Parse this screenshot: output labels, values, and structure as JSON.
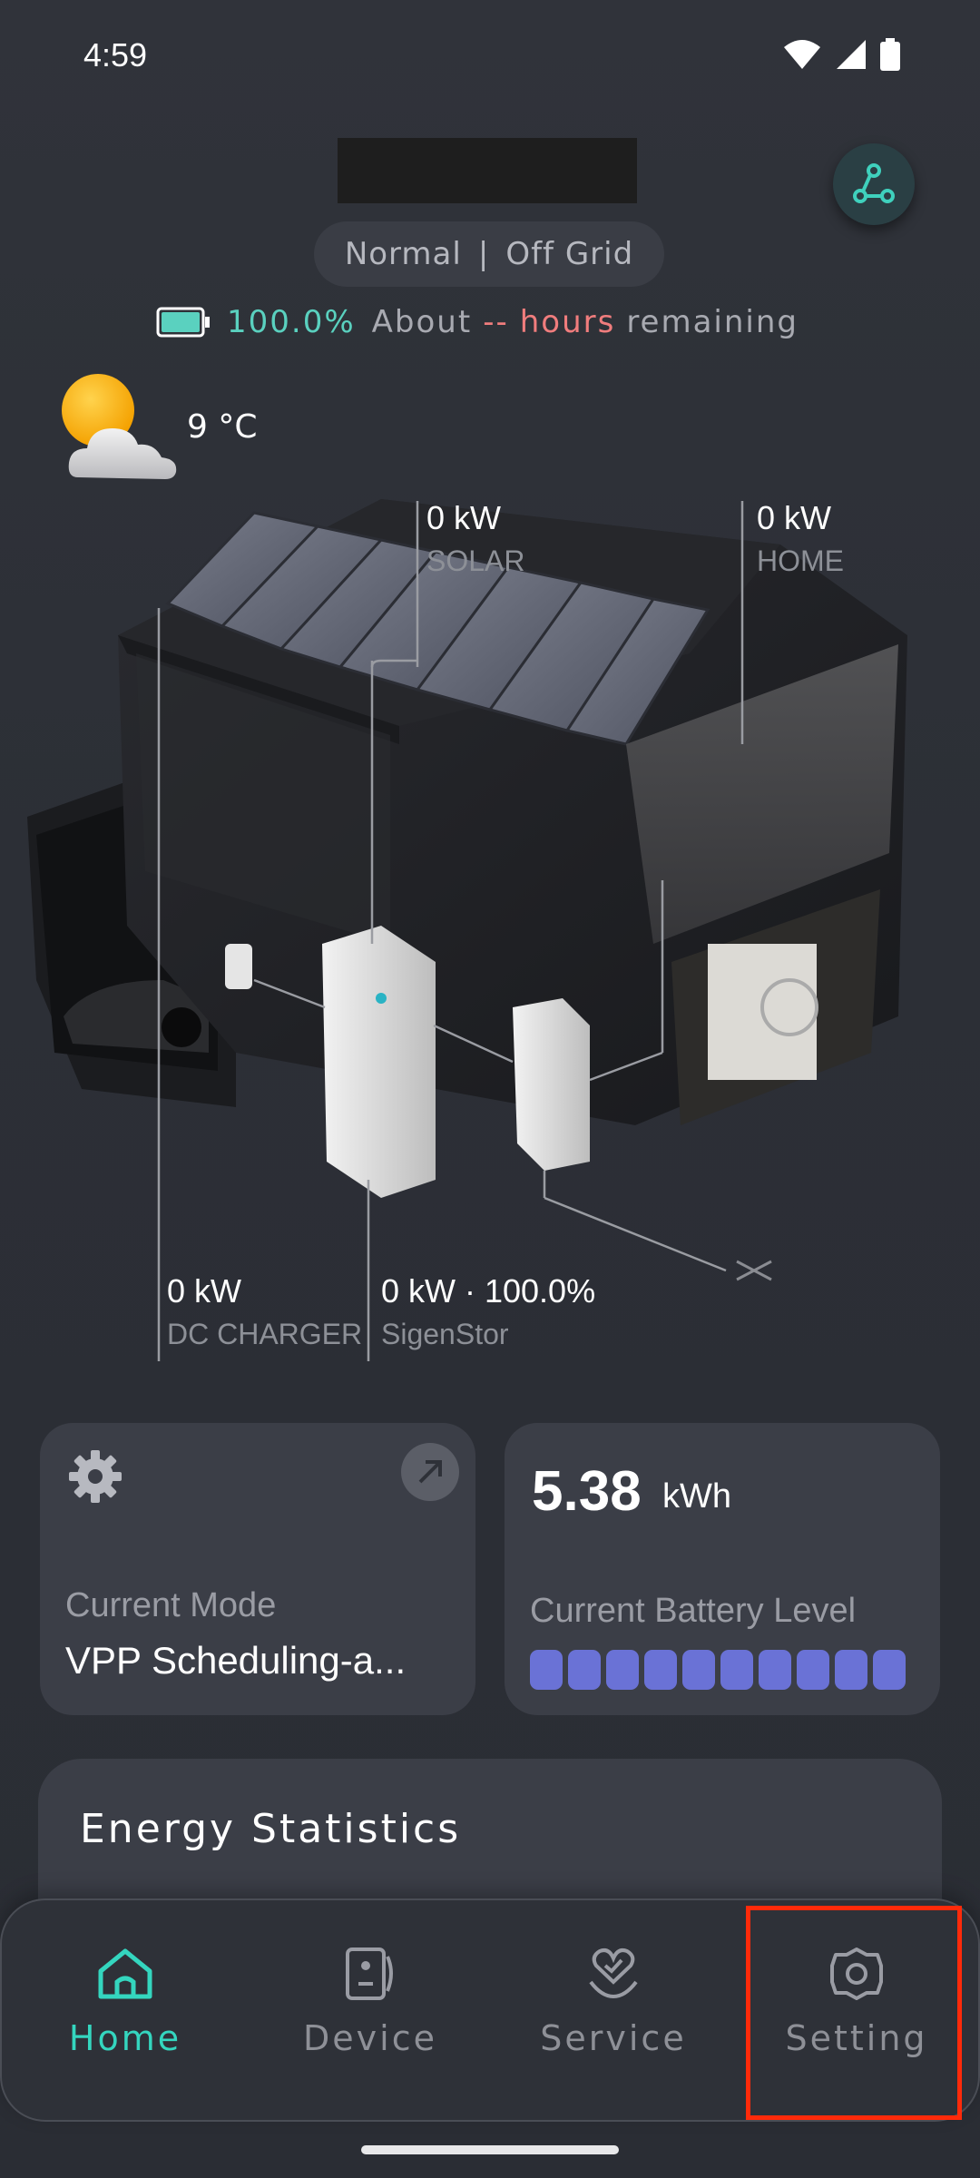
{
  "status_bar": {
    "time": "4:59"
  },
  "header": {
    "mode_left": "Normal",
    "mode_separator": "|",
    "mode_right": "Off Grid",
    "battery_percent": "100.0%",
    "about": "About",
    "hours_value": "--",
    "hours_word": "hours",
    "remaining": "remaining"
  },
  "weather": {
    "temperature": "9 °C",
    "icon": "sun-cloud-icon"
  },
  "flows": {
    "solar": {
      "value": "0 kW",
      "name": "SOLAR"
    },
    "home": {
      "value": "0 kW",
      "name": "HOME"
    },
    "dc_charger": {
      "value": "0 kW",
      "name": "DC CHARGER"
    },
    "sigenstor": {
      "value": "0 kW · 100.0%",
      "name": "SigenStor"
    }
  },
  "cards": {
    "mode": {
      "label": "Current Mode",
      "value": "VPP Scheduling-a..."
    },
    "battery": {
      "value": "5.38",
      "unit": "kWh",
      "label": "Current Battery Level",
      "level_fraction": 1.0
    }
  },
  "energy": {
    "title": "Energy Statistics"
  },
  "nav": {
    "items": [
      {
        "label": "Home",
        "icon": "home-icon"
      },
      {
        "label": "Device",
        "icon": "device-icon"
      },
      {
        "label": "Service",
        "icon": "service-icon"
      },
      {
        "label": "Setting",
        "icon": "gear-icon"
      }
    ]
  },
  "colors": {
    "accent": "#34d6bf",
    "warning": "#f07d7d",
    "battery_bar": "#6a72d6",
    "highlight": "#ff2a0a"
  }
}
